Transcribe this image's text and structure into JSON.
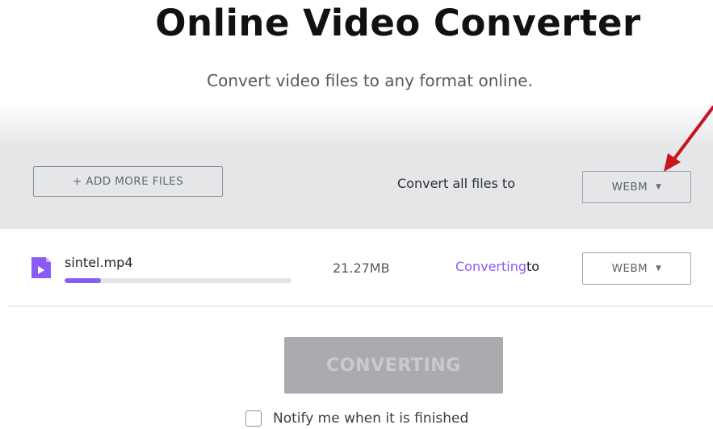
{
  "header": {
    "title": "Online Video Converter",
    "subtitle": "Convert video files to any format online."
  },
  "toolbar": {
    "add_files_label": "+ ADD MORE FILES",
    "convert_all_label": "Convert all files to",
    "format_all": "WEBM"
  },
  "files": [
    {
      "name": "sintel.mp4",
      "size": "21.27MB",
      "status": "Converting",
      "to_label": "to",
      "format": "WEBM",
      "progress_percent": 16
    }
  ],
  "actions": {
    "convert_button_label": "CONVERTING",
    "notify_label": "Notify me when it is finished",
    "notify_checked": false
  },
  "icons": {
    "file": "video-file-icon",
    "dropdown": "caret-down-icon",
    "annotation": "red-arrow-annotation"
  },
  "colors": {
    "accent": "#8a5cf6",
    "annotation": "#c8141e",
    "toolbar_bg": "#e4e6e8",
    "button_disabled": "#a9abae"
  }
}
